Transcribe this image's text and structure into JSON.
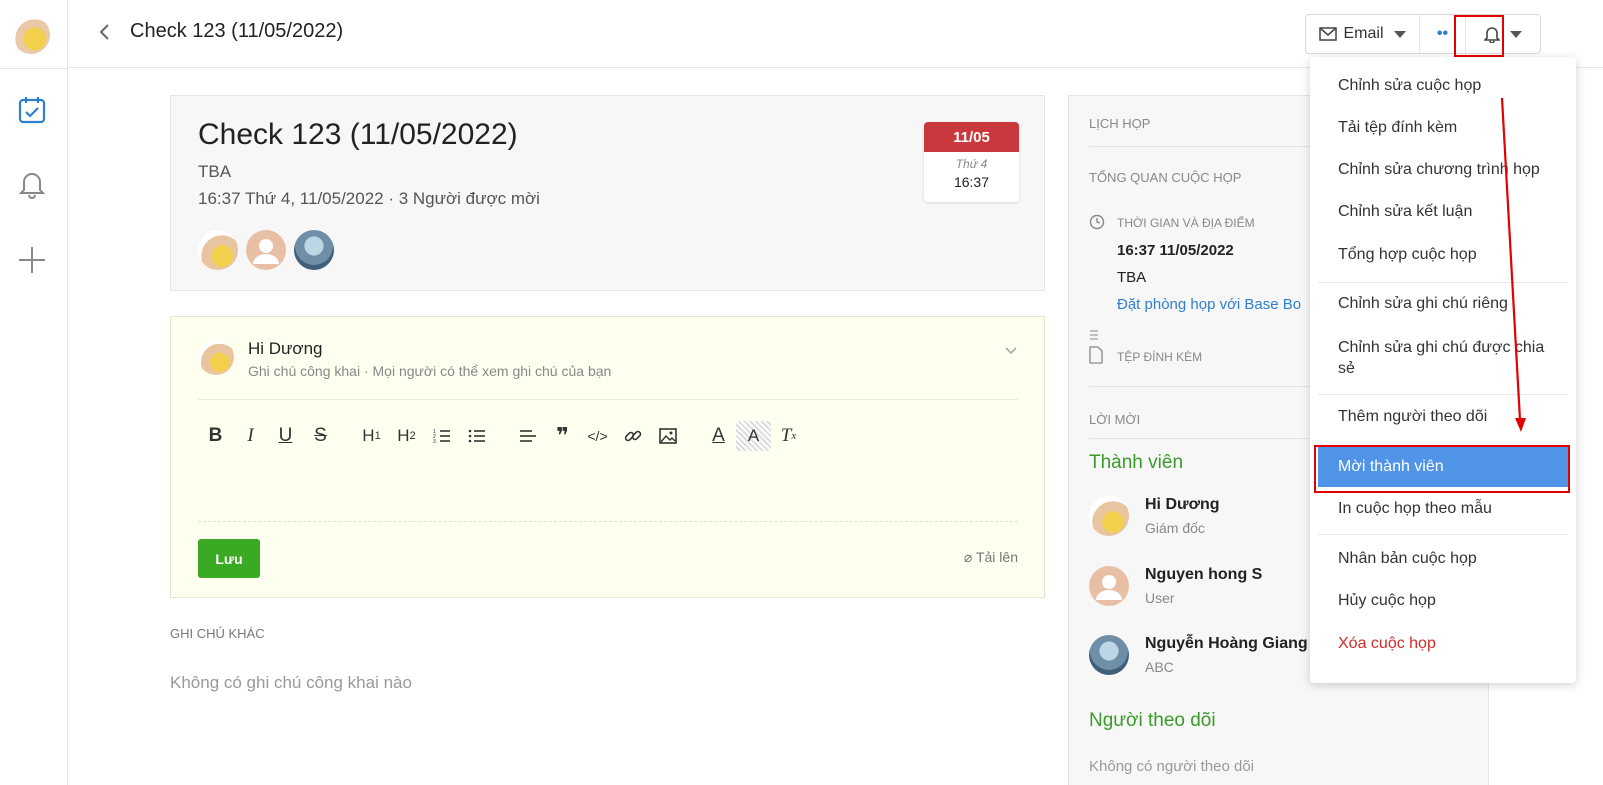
{
  "app": {
    "colors": {
      "accent_blue": "#4f94e6",
      "green": "#3aaa24",
      "red": "#c9383c",
      "danger": "#d32b2b"
    }
  },
  "header": {
    "title": "Check 123 (11/05/2022)",
    "email_label": "Email",
    "more_label": "••"
  },
  "meeting": {
    "title": "Check 123 (11/05/2022)",
    "location": "TBA",
    "summary": "16:37 Thứ 4, 11/05/2022 · 3 Người được mời",
    "date_badge": {
      "date": "11/05",
      "weekday": "Thứ 4",
      "time": "16:37"
    }
  },
  "note": {
    "author": "Hi Dương",
    "subtitle": "Ghi chú công khai · Mọi người có thể xem ghi chú của bạn",
    "save_label": "Lưu",
    "upload_label": "Tải lên"
  },
  "other_notes": {
    "heading": "GHI CHÚ KHÁC",
    "empty_text": "Không có ghi chú công khai nào"
  },
  "panel": {
    "calendar_heading": "LỊCH HỌP",
    "overview_heading": "TỔNG QUAN CUỘC HỌP",
    "time_place_label": "THỜI GIAN VÀ ĐỊA ĐIỂM",
    "datetime": "16:37 11/05/2022",
    "place": "TBA",
    "book_room_link": "Đặt phòng họp với Base Bo",
    "attachment_label": "TỆP ĐÍNH KÈM",
    "invite_heading": "LỜI MỜI",
    "members_heading": "Thành viên",
    "members": [
      {
        "name": "Hi Dương",
        "role": "Giám đốc"
      },
      {
        "name": "Nguyen hong S",
        "role": "User"
      },
      {
        "name": "Nguyễn Hoàng Giang",
        "role": "ABC"
      }
    ],
    "followers_heading": "Người theo dõi",
    "followers_empty": "Không có người theo dõi"
  },
  "menu": {
    "items": [
      "Chỉnh sửa cuộc họp",
      "Tải tệp đính kèm",
      "Chỉnh sửa chương trình họp",
      "Chỉnh sửa kết luận",
      "Tổng hợp cuộc họp",
      "Chỉnh sửa ghi chú riêng",
      "Chỉnh sửa ghi chú được chia sẻ",
      "Thêm người theo dõi",
      "Mời thành viên",
      "In cuộc họp theo mẫu",
      "Nhân bản cuộc họp",
      "Hủy cuộc họp",
      "Xóa cuộc họp"
    ]
  }
}
